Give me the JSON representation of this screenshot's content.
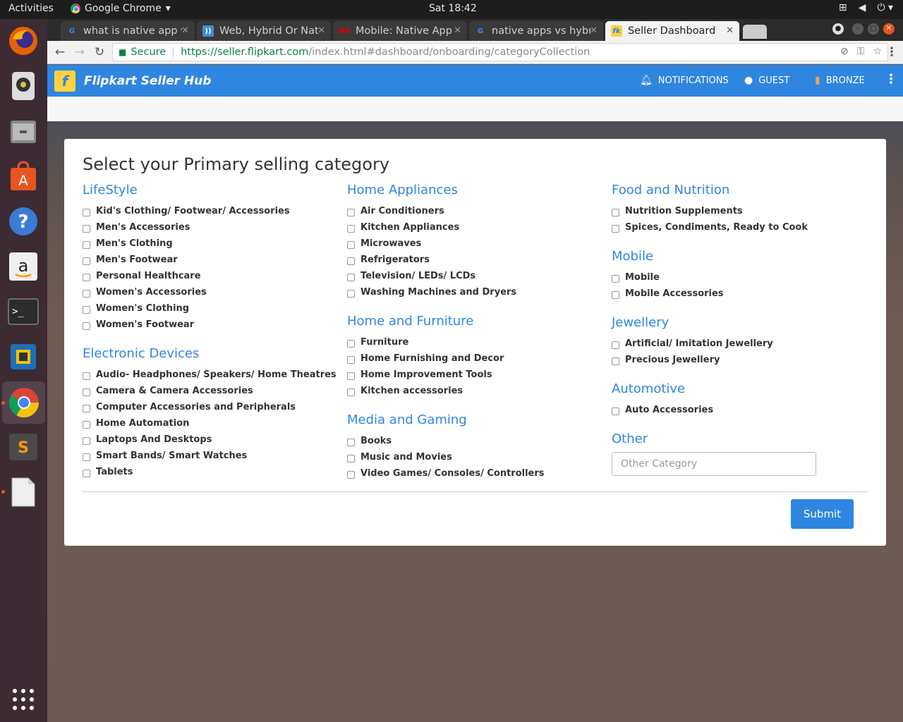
{
  "system": {
    "activities": "Activities",
    "app_name": "Google Chrome",
    "clock": "Sat 18:42"
  },
  "browser": {
    "tabs": [
      {
        "title": "what is native app v",
        "favicon": "G"
      },
      {
        "title": "Web, Hybrid Or Nat",
        "favicon": "))"
      },
      {
        "title": "Mobile: Native App",
        "favicon": "NN"
      },
      {
        "title": "native apps vs hybr",
        "favicon": "G"
      },
      {
        "title": "Seller Dashboard",
        "favicon": "fk"
      }
    ],
    "url": {
      "secure_label": "Secure",
      "scheme_host": "https://seller.flipkart.com",
      "path": "/index.html#dashboard/onboarding/categoryCollection"
    }
  },
  "header": {
    "brand": "Flipkart Seller Hub",
    "notifications": "NOTIFICATIONS",
    "guest": "GUEST",
    "bronze": "BRONZE"
  },
  "form": {
    "title": "Select your Primary selling category",
    "columns": [
      [
        {
          "title": "LifeStyle",
          "items": [
            "Kid's Clothing/ Footwear/ Accessories",
            "Men's Accessories",
            "Men's Clothing",
            "Men's Footwear",
            "Personal Healthcare",
            "Women's Accessories",
            "Women's Clothing",
            "Women's Footwear"
          ]
        },
        {
          "title": "Electronic Devices",
          "items": [
            "Audio- Headphones/ Speakers/ Home Theatres",
            "Camera & Camera Accessories",
            "Computer Accessories and Peripherals",
            "Home Automation",
            "Laptops And Desktops",
            "Smart Bands/ Smart Watches",
            "Tablets"
          ]
        }
      ],
      [
        {
          "title": "Home Appliances",
          "items": [
            "Air Conditioners",
            "Kitchen Appliances",
            "Microwaves",
            "Refrigerators",
            "Television/ LEDs/ LCDs",
            "Washing Machines and Dryers"
          ]
        },
        {
          "title": "Home and Furniture",
          "items": [
            "Furniture",
            "Home Furnishing and Decor",
            "Home Improvement Tools",
            "Kitchen accessories"
          ]
        },
        {
          "title": "Media and Gaming",
          "items": [
            "Books",
            "Music and Movies",
            "Video Games/ Consoles/ Controllers"
          ]
        }
      ],
      [
        {
          "title": "Food and Nutrition",
          "items": [
            "Nutrition Supplements",
            "Spices, Condiments, Ready to Cook"
          ]
        },
        {
          "title": "Mobile",
          "items": [
            "Mobile",
            "Mobile Accessories"
          ]
        },
        {
          "title": "Jewellery",
          "items": [
            "Artificial/ Imitation Jewellery",
            "Precious Jewellery"
          ]
        },
        {
          "title": "Automotive",
          "items": [
            "Auto Accessories"
          ]
        }
      ]
    ],
    "other_title": "Other",
    "other_placeholder": "Other Category",
    "submit_label": "Submit"
  },
  "colors": {
    "brand_blue": "#2f86e0",
    "flipkart_yellow": "#ffd33d",
    "secure_green": "#0b8043"
  }
}
